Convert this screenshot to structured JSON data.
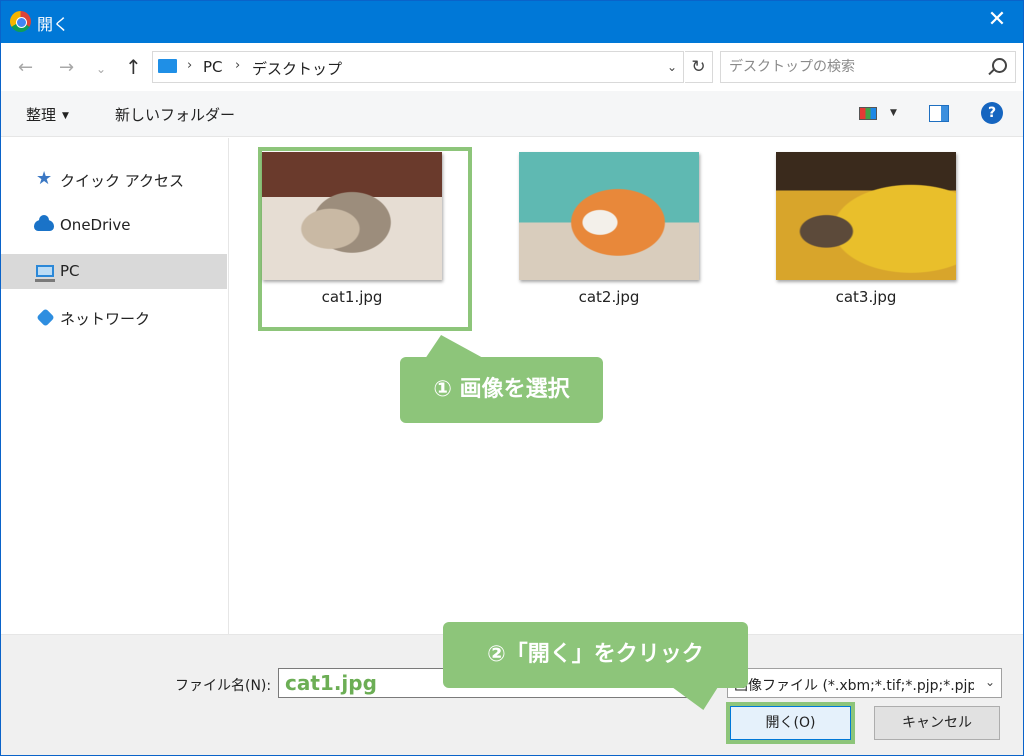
{
  "window": {
    "title": "開く",
    "close_icon": "close-icon"
  },
  "address": {
    "back_icon": "back-arrow-icon",
    "forward_icon": "forward-arrow-icon",
    "recent_icon": "chevron-down-icon",
    "up_icon": "up-arrow-icon",
    "path": [
      "PC",
      "デスクトップ"
    ],
    "search_placeholder": "デスクトップの検索"
  },
  "toolbar": {
    "organize": "整理",
    "new_folder": "新しいフォルダー",
    "help": "?"
  },
  "sidebar": {
    "items": [
      {
        "label": "クイック アクセス",
        "icon": "star-icon",
        "selected": false
      },
      {
        "label": "OneDrive",
        "icon": "cloud-icon",
        "selected": false
      },
      {
        "label": "PC",
        "icon": "pc-icon",
        "selected": true
      },
      {
        "label": "ネットワーク",
        "icon": "network-icon",
        "selected": false
      }
    ]
  },
  "files": [
    {
      "name": "cat1.jpg",
      "selected": true
    },
    {
      "name": "cat2.jpg",
      "selected": false
    },
    {
      "name": "cat3.jpg",
      "selected": false
    }
  ],
  "annotations": {
    "step1": "① 画像を選択",
    "step2": "②「開く」をクリック"
  },
  "footer": {
    "filename_label": "ファイル名(N):",
    "filename_value": "cat1.jpg",
    "filter_value": "画像ファイル (*.xbm;*.tif;*.pjp;*.pjpeg",
    "open_button": "開く(O)",
    "cancel_button": "キャンセル"
  },
  "colors": {
    "titlebar": "#0078d7",
    "highlight": "#8dc57a"
  }
}
